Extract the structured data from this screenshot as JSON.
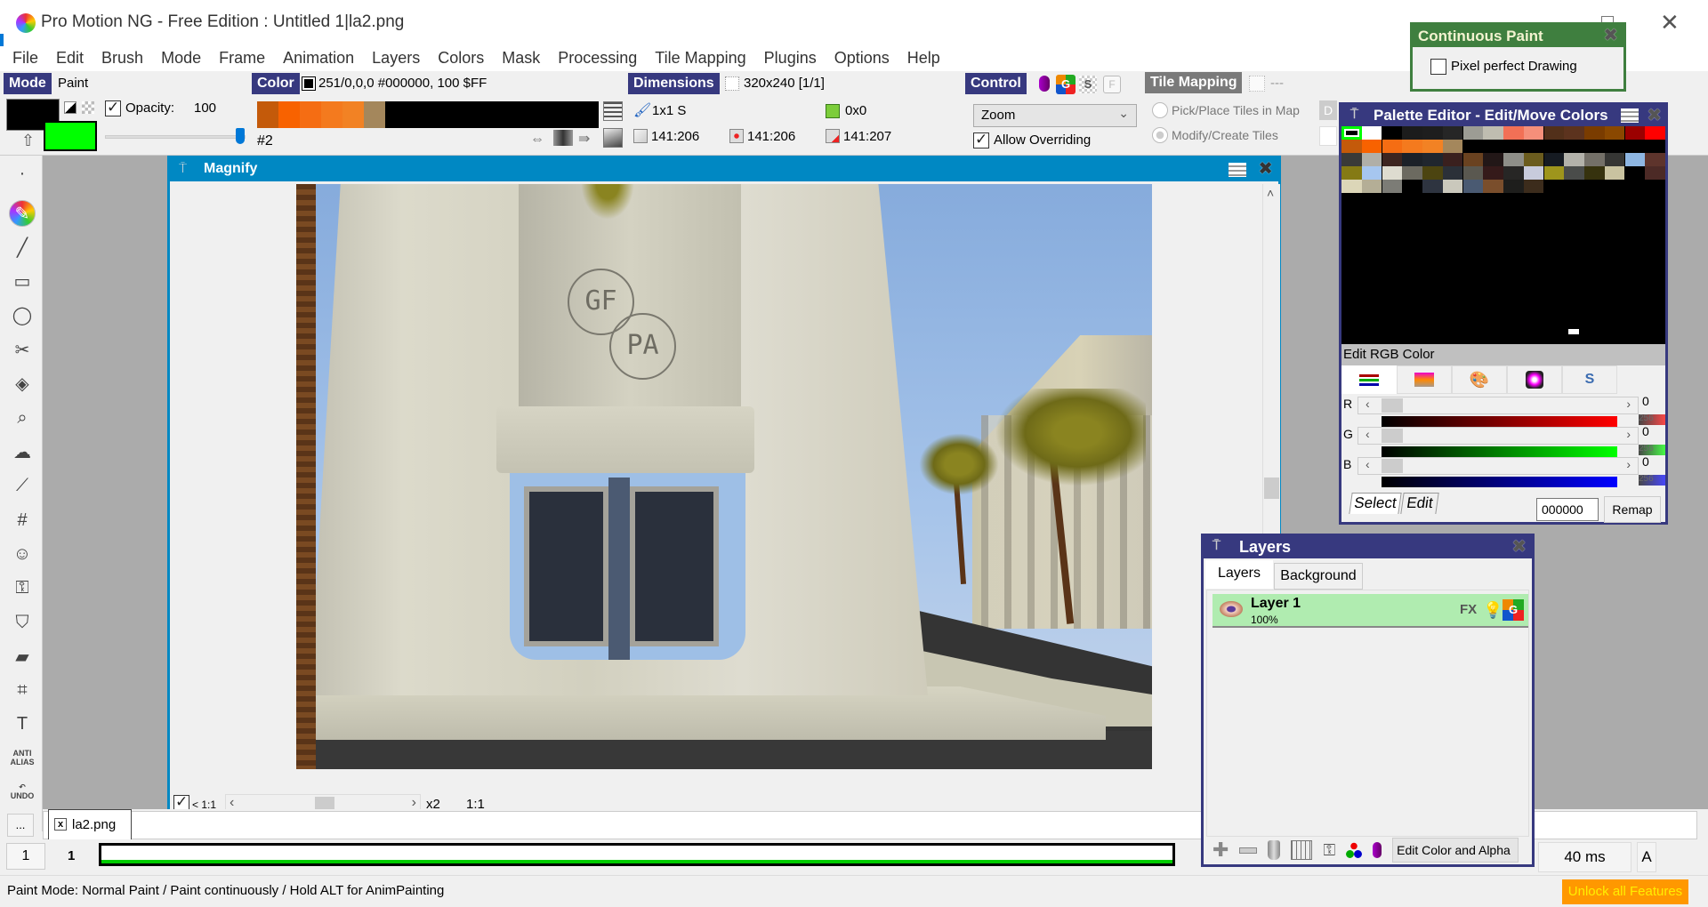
{
  "window": {
    "title": "Pro Motion NG - Free Edition : Untitled 1|la2.png",
    "close_glyph": "✕"
  },
  "menu": [
    "File",
    "Edit",
    "Brush",
    "Mode",
    "Frame",
    "Animation",
    "Layers",
    "Colors",
    "Mask",
    "Processing",
    "Tile Mapping",
    "Plugins",
    "Options",
    "Help"
  ],
  "toolbar": {
    "mode": {
      "label": "Mode",
      "value": "Paint"
    },
    "opacity": {
      "label": "Opacity:",
      "value": "100",
      "checked": true,
      "slider_fraction": 1.0
    },
    "foreground_color": "#000000",
    "background_color": "#00ff00",
    "color": {
      "label": "Color",
      "value": "251/0,0,0 #000000, 100 $FF",
      "index": "#2",
      "gradient_colors": [
        "#c45a0a",
        "#f86200",
        "#f56d13",
        "#f47a1e",
        "#f28224",
        "#a4875c"
      ]
    },
    "dimensions": {
      "label": "Dimensions",
      "value": "320x240 [1/1]",
      "brush_size": "1x1 S",
      "offset": "0x0",
      "coord1": "141:206",
      "coord2": "141:206",
      "coord3": "141:207"
    },
    "control": {
      "label": "Control",
      "dropdown_value": "Zoom",
      "allow_overriding_label": "Allow Overriding",
      "allow_overriding": true
    },
    "tile_mapping": {
      "label": "Tile Mapping",
      "value": "---",
      "option1": "Pick/Place Tiles in Map",
      "option2": "Modify/Create Tiles",
      "d_button": "D"
    }
  },
  "tools": [
    {
      "name": "dot",
      "glyph": "·"
    },
    {
      "name": "freehand",
      "glyph": "✎"
    },
    {
      "name": "line",
      "glyph": "╱"
    },
    {
      "name": "rectangle",
      "glyph": "▭"
    },
    {
      "name": "ellipse",
      "glyph": "◯"
    },
    {
      "name": "cut-brush",
      "glyph": "✂"
    },
    {
      "name": "fill",
      "glyph": "◈"
    },
    {
      "name": "magnifier",
      "glyph": "⌕"
    },
    {
      "name": "smudge",
      "glyph": "☁"
    },
    {
      "name": "eyedropper",
      "glyph": "⟋"
    },
    {
      "name": "grid",
      "glyph": "#"
    },
    {
      "name": "mask-face",
      "glyph": "☺"
    },
    {
      "name": "stencil-lock",
      "glyph": "⚿"
    },
    {
      "name": "mask",
      "glyph": "⛉"
    },
    {
      "name": "eraser",
      "glyph": "▰"
    },
    {
      "name": "crop",
      "glyph": "⌗"
    },
    {
      "name": "text",
      "glyph": "T"
    },
    {
      "name": "anti-alias",
      "glyph": "ANTI ALIAS"
    },
    {
      "name": "undo",
      "glyph": "↶ UNDO"
    }
  ],
  "magnify": {
    "title": "Magnify",
    "bottom": {
      "ratio_label": "< 1:1",
      "zoom": "x2",
      "ratio": "1:1",
      "checked": true
    }
  },
  "file_tabs": {
    "more_label": "...",
    "tabs": [
      {
        "label": "la2.png",
        "close": "x"
      }
    ]
  },
  "timeline": {
    "frame_button": "1",
    "frame_number": "1",
    "delay": "40 ms",
    "a_button": "A"
  },
  "status": {
    "text": "Paint Mode: Normal Paint / Paint continuously / Hold ALT for AnimPainting",
    "unlock": "Unlock all Features"
  },
  "continuous_paint": {
    "title": "Continuous Paint",
    "pixel_perfect_label": "Pixel perfect Drawing",
    "pixel_perfect": false
  },
  "palette_editor": {
    "title": "Palette Editor - Edit/Move Colors",
    "rows": [
      [
        "#000000",
        "#ffffff",
        "#000000",
        "#1c1c1c",
        "#1e1e1e",
        "#262626",
        "#9c9c94",
        "#bfbdb0",
        "#f27056",
        "#f58f7a",
        "#52301a",
        "#5c331e",
        "#7a3c00",
        "#8a4800",
        "#9b0000",
        "#ff0000"
      ],
      [
        "#c45a0a",
        "#f86200",
        "#f56d13",
        "#f47a1e",
        "#f28224",
        "#a4875c",
        "#000000",
        "#000000",
        "#000000",
        "#000000",
        "#000000",
        "#000000",
        "#000000",
        "#000000",
        "#000000",
        "#000000"
      ],
      [
        "#3a3a38",
        "#b0afa8",
        "#3d2520",
        "#1c2128",
        "#20262e",
        "#3a201e",
        "#6a4220",
        "#221717",
        "#8e8e88",
        "#6b5c1e",
        "#161b22",
        "#b3b2aa",
        "#747068",
        "#363634",
        "#8eb6e2",
        "#5e342c"
      ],
      [
        "#857a14",
        "#a6c6ef",
        "#dedcd0",
        "#6c6a60",
        "#4c4410",
        "#2b3038",
        "#5a5850",
        "#351a1a",
        "#272625",
        "#c8cbdc",
        "#9e951c",
        "#4a4c4a",
        "#36320e",
        "#c9c3a0",
        "#000000",
        "#4c2a26"
      ],
      [
        "#dcd6b8",
        "#b4ae96",
        "#7c7c76",
        "#000000",
        "#2e3440",
        "#cac8bc",
        "#4a5a72",
        "#7a4e2c",
        "#1e1e1c",
        "#3c2c1c",
        "#000000",
        "#000000",
        "#000000",
        "#000000",
        "#000000",
        "#000000"
      ]
    ],
    "selected_index": 0,
    "edit_rgb_label": "Edit RGB Color",
    "channels": [
      {
        "label": "R",
        "value": "0",
        "max": "256",
        "color": "#ff0000"
      },
      {
        "label": "G",
        "value": "0",
        "max": "256",
        "color": "#00ff00"
      },
      {
        "label": "B",
        "value": "0",
        "max": "256",
        "color": "#0000ff"
      }
    ],
    "tabs": [
      "Select",
      "Edit"
    ],
    "hex_value": "000000",
    "remap_label": "Remap"
  },
  "layers_panel": {
    "title": "Layers",
    "tabs": [
      "Layers",
      "Background"
    ],
    "layers": [
      {
        "name": "Layer 1",
        "opacity": "100%",
        "fx": "FX",
        "color": "#b0ecb0"
      }
    ],
    "edit_button": "Edit Color and Alpha"
  }
}
